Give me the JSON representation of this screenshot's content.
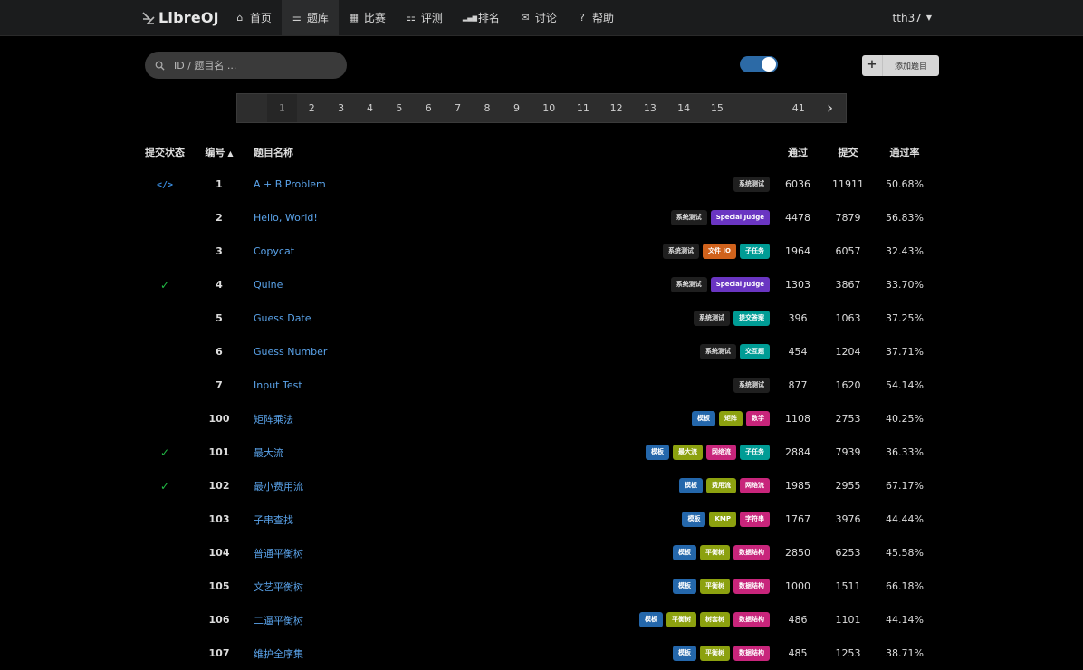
{
  "nav": {
    "brand": "LibreOJ",
    "items": [
      {
        "label": "首页",
        "icon": "home-icon",
        "glyph": "⌂",
        "active": false
      },
      {
        "label": "题库",
        "icon": "list-icon",
        "glyph": "☰",
        "active": true
      },
      {
        "label": "比赛",
        "icon": "calendar-icon",
        "glyph": "▦",
        "active": false
      },
      {
        "label": "评测",
        "icon": "tasks-icon",
        "glyph": "☷",
        "active": false
      },
      {
        "label": "排名",
        "icon": "signal-icon",
        "glyph": "▂▄▆",
        "active": false
      },
      {
        "label": "讨论",
        "icon": "comments-icon",
        "glyph": "✉",
        "active": false
      },
      {
        "label": "帮助",
        "icon": "help-icon",
        "glyph": "?",
        "active": false
      }
    ],
    "user": "tth37"
  },
  "search": {
    "placeholder": "ID / 题目名 ..."
  },
  "toggle": {
    "on": true,
    "color": "#2c6aa6"
  },
  "add_button": {
    "label": "添加题目",
    "icon": "plus-icon"
  },
  "pagination": {
    "pages": [
      "1",
      "2",
      "3",
      "4",
      "5",
      "6",
      "7",
      "8",
      "9",
      "10",
      "11",
      "12",
      "13",
      "14",
      "15",
      "41"
    ],
    "current": "1",
    "next_icon": "chevron-right-icon"
  },
  "table": {
    "headers": {
      "status": "提交状态",
      "id": "编号",
      "name": "题目名称",
      "accepted": "通过",
      "submitted": "提交",
      "rate": "通过率"
    },
    "rows": [
      {
        "status": "code",
        "id": "1",
        "name": "A + B Problem",
        "tags": [
          {
            "label": "系统测试",
            "color": "sys"
          }
        ],
        "accepted": "6036",
        "submitted": "11911",
        "rate": "50.68%"
      },
      {
        "status": "",
        "id": "2",
        "name": "Hello, World!",
        "tags": [
          {
            "label": "系统测试",
            "color": "sys"
          },
          {
            "label": "Special Judge",
            "color": "purple"
          }
        ],
        "accepted": "4478",
        "submitted": "7879",
        "rate": "56.83%"
      },
      {
        "status": "",
        "id": "3",
        "name": "Copycat",
        "tags": [
          {
            "label": "系统测试",
            "color": "sys"
          },
          {
            "label": "文件 IO",
            "color": "orange"
          },
          {
            "label": "子任务",
            "color": "teal"
          }
        ],
        "accepted": "1964",
        "submitted": "6057",
        "rate": "32.43%"
      },
      {
        "status": "accepted",
        "id": "4",
        "name": "Quine",
        "tags": [
          {
            "label": "系统测试",
            "color": "sys"
          },
          {
            "label": "Special Judge",
            "color": "purple"
          }
        ],
        "accepted": "1303",
        "submitted": "3867",
        "rate": "33.70%"
      },
      {
        "status": "",
        "id": "5",
        "name": "Guess Date",
        "tags": [
          {
            "label": "系统测试",
            "color": "sys"
          },
          {
            "label": "提交答案",
            "color": "teal"
          }
        ],
        "accepted": "396",
        "submitted": "1063",
        "rate": "37.25%"
      },
      {
        "status": "",
        "id": "6",
        "name": "Guess Number",
        "tags": [
          {
            "label": "系统测试",
            "color": "sys"
          },
          {
            "label": "交互题",
            "color": "teal"
          }
        ],
        "accepted": "454",
        "submitted": "1204",
        "rate": "37.71%"
      },
      {
        "status": "",
        "id": "7",
        "name": "Input Test",
        "tags": [
          {
            "label": "系统测试",
            "color": "sys"
          }
        ],
        "accepted": "877",
        "submitted": "1620",
        "rate": "54.14%"
      },
      {
        "status": "",
        "id": "100",
        "name": "矩阵乘法",
        "tags": [
          {
            "label": "模板",
            "color": "blue"
          },
          {
            "label": "矩阵",
            "color": "olive"
          },
          {
            "label": "数学",
            "color": "pink"
          }
        ],
        "accepted": "1108",
        "submitted": "2753",
        "rate": "40.25%"
      },
      {
        "status": "accepted",
        "id": "101",
        "name": "最大流",
        "tags": [
          {
            "label": "模板",
            "color": "blue"
          },
          {
            "label": "最大流",
            "color": "olive"
          },
          {
            "label": "网络流",
            "color": "pink"
          },
          {
            "label": "子任务",
            "color": "teal"
          }
        ],
        "accepted": "2884",
        "submitted": "7939",
        "rate": "36.33%"
      },
      {
        "status": "accepted",
        "id": "102",
        "name": "最小费用流",
        "tags": [
          {
            "label": "模板",
            "color": "blue"
          },
          {
            "label": "费用流",
            "color": "olive"
          },
          {
            "label": "网络流",
            "color": "pink"
          }
        ],
        "accepted": "1985",
        "submitted": "2955",
        "rate": "67.17%"
      },
      {
        "status": "",
        "id": "103",
        "name": "子串查找",
        "tags": [
          {
            "label": "模板",
            "color": "blue"
          },
          {
            "label": "KMP",
            "color": "olive"
          },
          {
            "label": "字符串",
            "color": "pink"
          }
        ],
        "accepted": "1767",
        "submitted": "3976",
        "rate": "44.44%"
      },
      {
        "status": "",
        "id": "104",
        "name": "普通平衡树",
        "tags": [
          {
            "label": "模板",
            "color": "blue"
          },
          {
            "label": "平衡树",
            "color": "olive"
          },
          {
            "label": "数据结构",
            "color": "pink"
          }
        ],
        "accepted": "2850",
        "submitted": "6253",
        "rate": "45.58%"
      },
      {
        "status": "",
        "id": "105",
        "name": "文艺平衡树",
        "tags": [
          {
            "label": "模板",
            "color": "blue"
          },
          {
            "label": "平衡树",
            "color": "olive"
          },
          {
            "label": "数据结构",
            "color": "pink"
          }
        ],
        "accepted": "1000",
        "submitted": "1511",
        "rate": "66.18%"
      },
      {
        "status": "",
        "id": "106",
        "name": "二逼平衡树",
        "tags": [
          {
            "label": "模板",
            "color": "blue"
          },
          {
            "label": "平衡树",
            "color": "olive"
          },
          {
            "label": "树套树",
            "color": "olive"
          },
          {
            "label": "数据结构",
            "color": "pink"
          }
        ],
        "accepted": "486",
        "submitted": "1101",
        "rate": "44.14%"
      },
      {
        "status": "",
        "id": "107",
        "name": "维护全序集",
        "tags": [
          {
            "label": "模板",
            "color": "blue"
          },
          {
            "label": "平衡树",
            "color": "olive"
          },
          {
            "label": "数据结构",
            "color": "pink"
          }
        ],
        "accepted": "485",
        "submitted": "1253",
        "rate": "38.71%"
      }
    ]
  }
}
